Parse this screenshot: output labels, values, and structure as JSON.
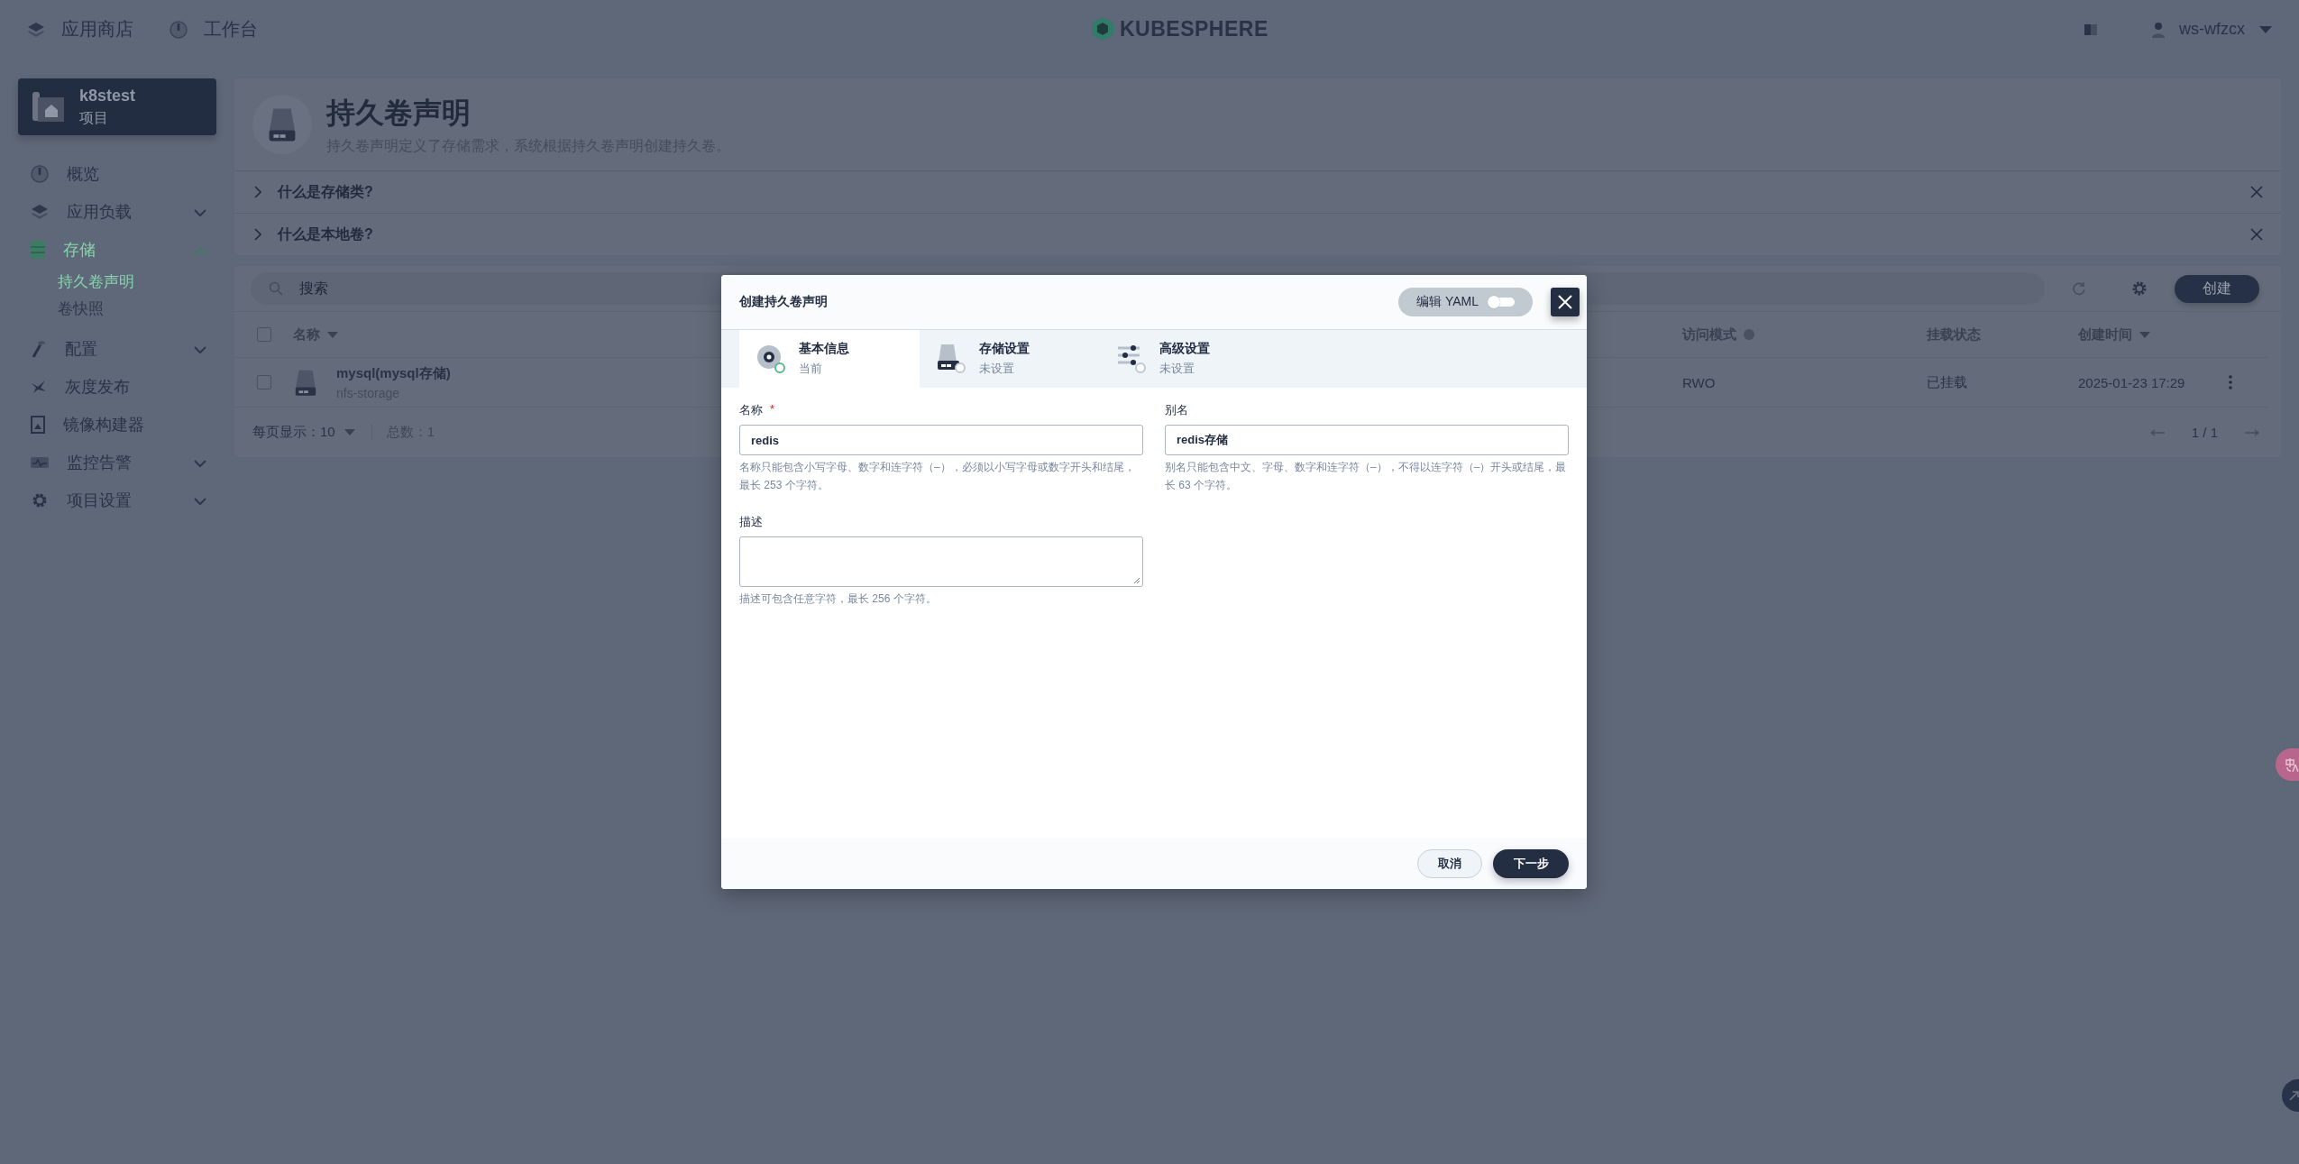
{
  "top_bar": {
    "nav": [
      {
        "label": "应用商店"
      },
      {
        "label": "工作台"
      }
    ],
    "logo": "KUBESPHERE",
    "user": "ws-wfzcx"
  },
  "project": {
    "name": "k8stest",
    "type": "项目"
  },
  "sidebar": {
    "items": [
      {
        "label": "概览",
        "selected": false
      },
      {
        "label": "应用负载",
        "selected": false,
        "expanded": false
      },
      {
        "label": "存储",
        "selected": true,
        "expanded": true,
        "children": [
          {
            "label": "持久卷声明",
            "selected": true
          },
          {
            "label": "卷快照",
            "selected": false
          }
        ]
      },
      {
        "label": "配置",
        "selected": false,
        "expanded": false
      },
      {
        "label": "灰度发布",
        "selected": false
      },
      {
        "label": "镜像构建器",
        "selected": false
      },
      {
        "label": "监控告警",
        "selected": false,
        "expanded": false
      },
      {
        "label": "项目设置",
        "selected": false,
        "expanded": false
      }
    ]
  },
  "page_header": {
    "title": "持久卷声明",
    "description": "持久卷声明定义了存储需求，系统根据持久卷声明创建持久卷。",
    "tips": [
      {
        "label": "什么是存储类?"
      },
      {
        "label": "什么是本地卷?"
      }
    ]
  },
  "table": {
    "search": {
      "placeholder": "搜索"
    },
    "create_button": "创建",
    "all_selected": false,
    "columns": [
      {
        "label": "名称",
        "sortable": true
      },
      {
        "label": "访问模式",
        "help": true
      },
      {
        "label": "挂载状态"
      },
      {
        "label": "创建时间",
        "sortable": true
      }
    ],
    "rows": [
      {
        "name": "mysql(mysql存储)",
        "storage_class": "nfs-storage",
        "access_mode": "RWO",
        "status": "已挂载",
        "created": "2025-01-23 17:29",
        "selected": false
      }
    ],
    "footer": {
      "per_page": "每页显示：10",
      "total": "总数：1",
      "page": "1 / 1"
    }
  },
  "modal": {
    "title": "创建持久卷声明",
    "yaml_toggle": {
      "label": "编辑 YAML",
      "on": false
    },
    "steps": [
      {
        "title": "基本信息",
        "status": "当前",
        "selected": true
      },
      {
        "title": "存储设置",
        "status": "未设置",
        "selected": false
      },
      {
        "title": "高级设置",
        "status": "未设置",
        "selected": false
      }
    ],
    "fields": [
      {
        "kind": "input",
        "label": "名称",
        "required_mark": "*",
        "value": "redis",
        "hint": "名称只能包含小写字母、数字和连字符（–），必须以小写字母或数字开头和结尾，最长 253 个字符。"
      },
      {
        "kind": "input",
        "label": "别名",
        "value": "redis存储",
        "hint": "别名只能包含中文、字母、数字和连字符（–），不得以连字符（–）开头或结尾，最长 63 个字符。"
      },
      {
        "kind": "textarea",
        "label": "描述",
        "hint": "描述可包含任意字符，最长 256 个字符。"
      }
    ],
    "buttons": {
      "cancel": "取消",
      "next": "下一步"
    }
  }
}
